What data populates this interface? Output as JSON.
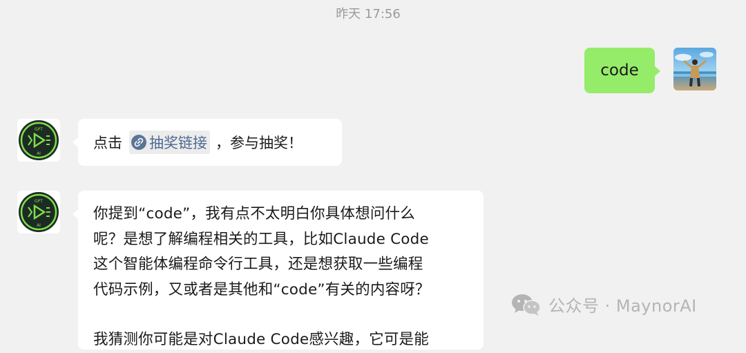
{
  "timestamp": "昨天 17:56",
  "messages": {
    "user_message": "code",
    "bot_message_1": {
      "prefix": "点击",
      "link_label": "抽奖链接",
      "suffix": "，参与抽奖！"
    },
    "bot_message_2": {
      "lines": [
        "你提到“code”，我有点不太明白你具体想问什么",
        "呢？是想了解编程相关的工具，比如Claude Code",
        "这个智能体编程命令行工具，还是想获取一些编程",
        "代码示例，又或者是其他和“code”有关的内容呀？",
        "",
        "我猜测你可能是对Claude Code感兴趣，它可是能"
      ]
    }
  },
  "avatars": {
    "user": "user-photo-avatar",
    "bot": "bot-logo-avatar",
    "bot_logo_top_text": "GPT",
    "bot_logo_bottom_text": "AI"
  },
  "watermark": {
    "text": "公众号 · MaynorAI",
    "icon": "wechat-icon"
  },
  "colors": {
    "background": "#f1f1f1",
    "user_bubble": "#95ec69",
    "bot_bubble": "#ffffff",
    "link": "#4e6a92"
  }
}
